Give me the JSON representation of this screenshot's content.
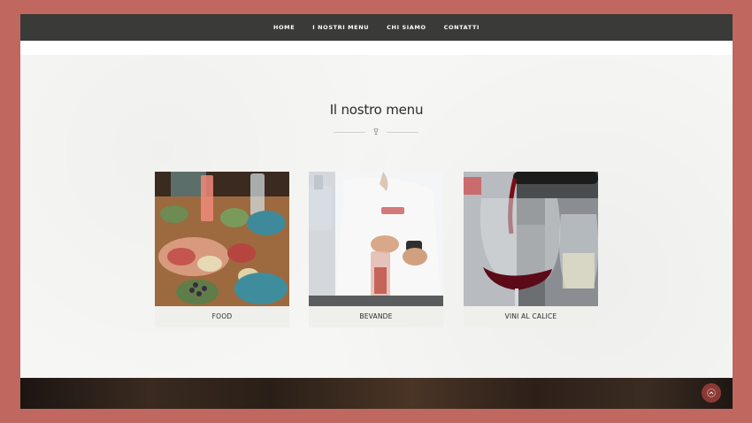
{
  "nav": {
    "items": [
      {
        "label": "HOME"
      },
      {
        "label": "I NOSTRI MENU"
      },
      {
        "label": "CHI SIAMO"
      },
      {
        "label": "CONTATTI"
      }
    ]
  },
  "section": {
    "title": "Il nostro menu",
    "divider_icon": "wine-glass-icon"
  },
  "cards": [
    {
      "label": "FOOD",
      "image": "food-platter-photo"
    },
    {
      "label": "BEVANDE",
      "image": "bartender-photo"
    },
    {
      "label": "VINI AL CALICE",
      "image": "red-wine-glass-photo"
    }
  ],
  "colors": {
    "page_border": "#c0675f",
    "navbar": "#3a3a38",
    "accent": "#8a3a34"
  },
  "scroll_top": {
    "icon": "chevron-up-icon"
  }
}
